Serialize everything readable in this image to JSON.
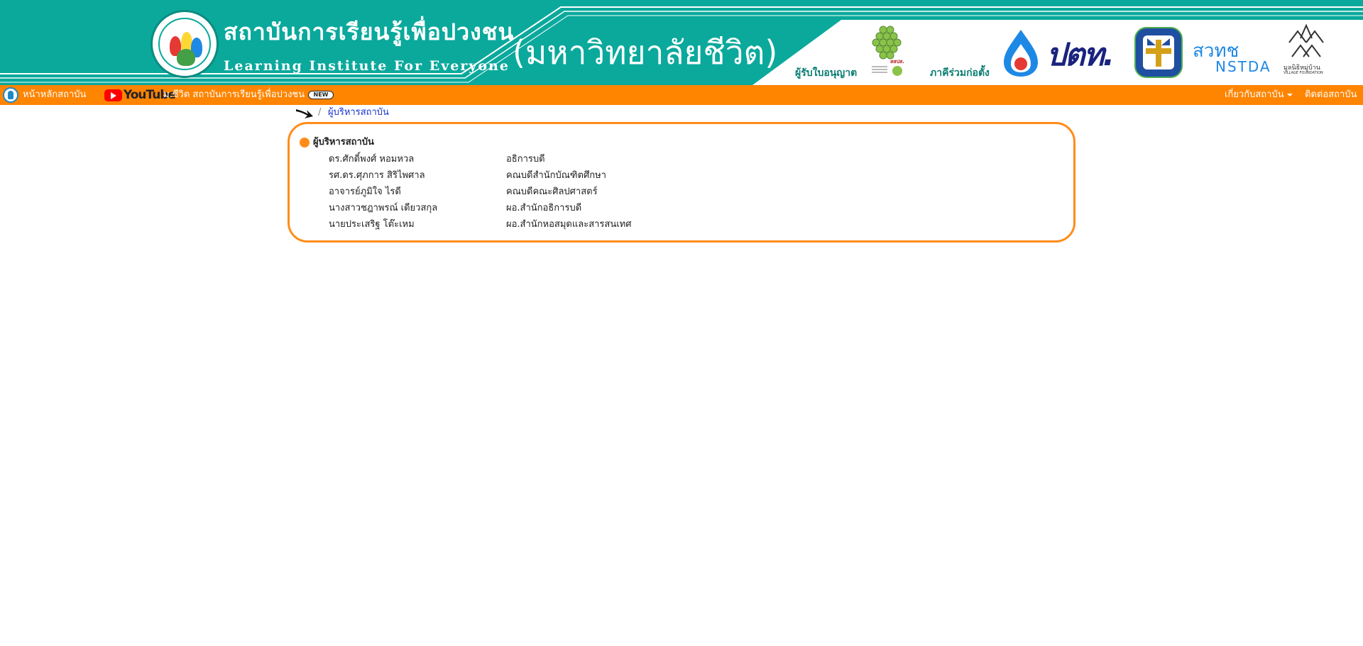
{
  "header": {
    "title_th": "สถาบันการเรียนรู้เพื่อปวงชน",
    "title_en": "Learning Institute For Everyone",
    "subtitle": "(มหาวิทยาลัยชีวิต)",
    "seal_text": "สถาบันการเรียนรู้เพื่อปวงชน Learning Institute For Everyone",
    "licensee_label": "ผู้รับใบอนุญาต",
    "partner_label": "ภาคีร่วมก่อตั้ง",
    "logos": {
      "ceif_text": "สสปส.",
      "ptt_text": "ปตท.",
      "nstda_th": "สวทช",
      "nstda_en": "NSTDA",
      "village_th": "มูลนิธิหมู่บ้าน",
      "village_en": "VILLAGE FOUNDATION"
    }
  },
  "nav": {
    "home_label": "หน้าหลักสถาบัน",
    "youtube_brand": "YouTube",
    "youtube_label": "ม.ชีวิต สถาบันการเรียนรู้เพื่อปวงชน",
    "new_badge": "NEW",
    "about_label": "เกี่ยวกับสถาบัน",
    "contact_label": "ติดต่อสถาบัน"
  },
  "breadcrumb": {
    "separator": "/",
    "current": "ผู้บริหารสถาบัน"
  },
  "section": {
    "title": "ผู้บริหารสถาบัน",
    "executives": [
      {
        "name": "ดร.ศักดิ์พงศ์ หอมหวล",
        "position": "อธิการบดี"
      },
      {
        "name": "รศ.ดร.ศุภการ สิริไพศาล",
        "position": "คณบดีสำนักบัณฑิตศึกษา"
      },
      {
        "name": "อาจารย์ภูมิใจ ไรดี",
        "position": "คณบดีคณะศิลปศาสตร์"
      },
      {
        "name": "นางสาวชฎาพรณ์ เดียวสกุล",
        "position": "ผอ.สำนักอธิการบดี"
      },
      {
        "name": "นายประเสริฐ โต๊ะเหม",
        "position": "ผอ.สำนักหอสมุดและสารสนเทศ"
      }
    ]
  },
  "colors": {
    "banner_teal": "#0aa99c",
    "nav_orange": "#ff8400",
    "panel_border": "#ff8c1a",
    "link_blue": "#1a33cc"
  }
}
